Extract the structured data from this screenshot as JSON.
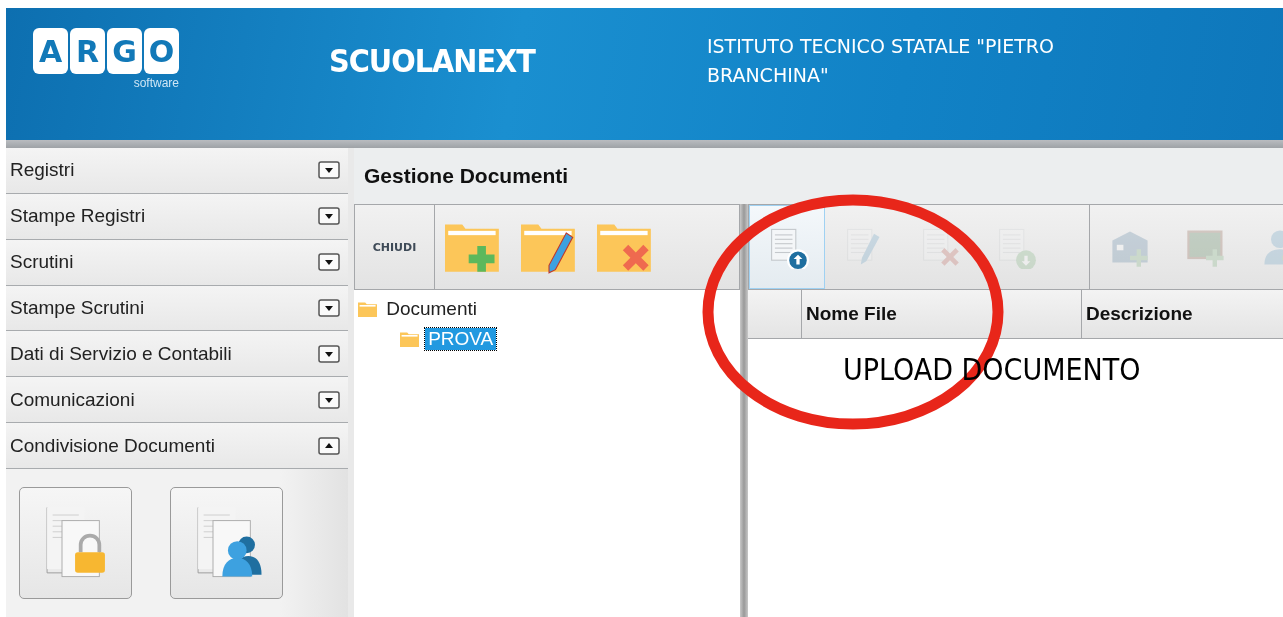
{
  "header": {
    "logo_letters": [
      "A",
      "R",
      "G",
      "O"
    ],
    "logo_sub": "software",
    "product": "SCUOLANEXT",
    "institute": [
      "ISTITUTO TECNICO STATALE \"PIETRO",
      "BRANCHINA\""
    ]
  },
  "sidebar": {
    "items": [
      {
        "label": "Registri",
        "expanded": false
      },
      {
        "label": "Stampe Registri",
        "expanded": false
      },
      {
        "label": "Scrutini",
        "expanded": false
      },
      {
        "label": "Stampe Scrutini",
        "expanded": false
      },
      {
        "label": "Dati di Servizio e Contabili",
        "expanded": false
      },
      {
        "label": "Comunicazioni",
        "expanded": false
      },
      {
        "label": "Condivisione Documenti",
        "expanded": true
      }
    ],
    "panel_buttons": [
      {
        "kind": "lock"
      },
      {
        "kind": "users"
      }
    ]
  },
  "main": {
    "title": "Gestione Documenti",
    "folder_toolbar": {
      "close_label": "CHIUDI",
      "tools": [
        {
          "kind": "add"
        },
        {
          "kind": "edit"
        },
        {
          "kind": "delete"
        }
      ]
    },
    "file_toolbar": [
      {
        "kind": "upload",
        "disabled": false,
        "selected": true
      },
      {
        "kind": "edit",
        "disabled": true,
        "selected": false
      },
      {
        "kind": "delete",
        "disabled": true,
        "selected": false
      },
      {
        "kind": "download",
        "disabled": true,
        "selected": false
      },
      {
        "kind": "separator"
      },
      {
        "kind": "building",
        "disabled": true,
        "selected": false
      },
      {
        "kind": "board",
        "disabled": true,
        "selected": false
      },
      {
        "kind": "person",
        "disabled": true,
        "selected": false
      }
    ],
    "tree": [
      {
        "label": "Documenti",
        "selected": false,
        "children": [
          {
            "label": "PROVA",
            "selected": true
          }
        ]
      }
    ],
    "table": {
      "columns": [
        "Nome File",
        "Descrizione"
      ]
    }
  },
  "annotation": {
    "text": "UPLOAD DOCUMENTO"
  }
}
